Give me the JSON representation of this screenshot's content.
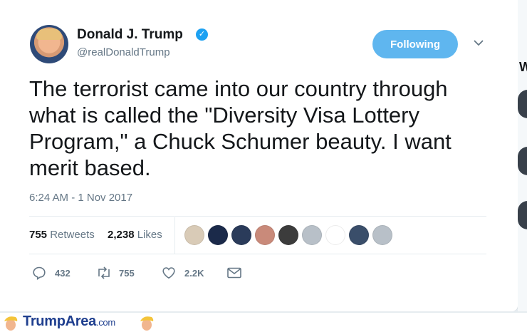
{
  "tweet": {
    "author_name": "Donald J. Trump",
    "handle": "@realDonaldTrump",
    "follow_label": "Following",
    "text": "The terrorist came into our country through what is called the \"Diversity Visa Lottery Program,\" a Chuck Schumer beauty. I want merit based.",
    "timestamp": "6:24 AM - 1 Nov 2017"
  },
  "stats": {
    "retweets_count": "755",
    "retweets_label": "Retweets",
    "likes_count": "2,238",
    "likes_label": "Likes"
  },
  "liker_avatar_colors": [
    "#d9cbb7",
    "#1b2a4a",
    "#2a3b5a",
    "#c98a7a",
    "#3c3c3c",
    "#b8c0c8",
    "#ffffff",
    "#3a4e6a",
    "#b8c0c8"
  ],
  "actions": {
    "reply_count": "432",
    "retweet_count": "755",
    "like_count": "2.2K"
  },
  "footer": {
    "brand_name": "TrumpArea",
    "brand_suffix": ".com"
  },
  "side_panel": {
    "heading_fragment": "W"
  },
  "colors": {
    "accent": "#1da1f2",
    "follow_button": "#5fb6ef",
    "text": "#14171a",
    "muted": "#657786"
  }
}
